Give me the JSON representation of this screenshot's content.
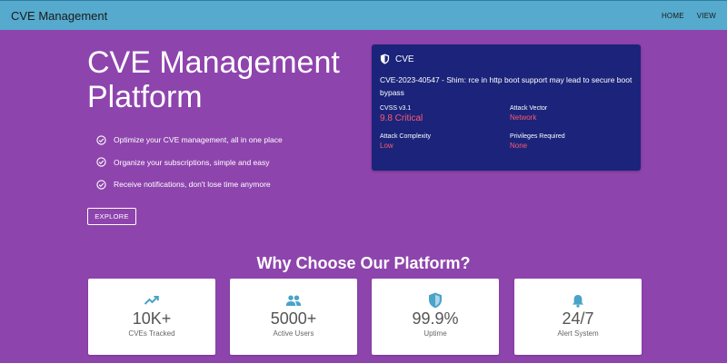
{
  "navbar": {
    "brand": "CVE Management",
    "links": [
      "HOME",
      "VIEW"
    ]
  },
  "hero": {
    "title": "CVE Management Platform",
    "features": [
      "Optimize your CVE management, all in one place",
      "Organize your subscriptions, simple and easy",
      "Receive notifications, don't lose time anymore"
    ],
    "explore_label": "EXPLORE"
  },
  "cve_card": {
    "header": "CVE",
    "description": "CVE-2023-40547 - Shim: rce in http boot support may lead to secure boot bypass",
    "metrics": [
      {
        "label": "CVSS v3.1",
        "value": "9.8 Critical"
      },
      {
        "label": "Attack Vector",
        "value": "Network"
      },
      {
        "label": "Attack Complexity",
        "value": "Low"
      },
      {
        "label": "Privileges Required",
        "value": "None"
      }
    ]
  },
  "why": {
    "title": "Why Choose Our Platform?",
    "stats": [
      {
        "icon": "trending-up-icon",
        "value": "10K+",
        "label": "CVEs Tracked"
      },
      {
        "icon": "users-icon",
        "value": "5000+",
        "label": "Active Users"
      },
      {
        "icon": "shield-check-icon",
        "value": "99.9%",
        "label": "Uptime"
      },
      {
        "icon": "bell-icon",
        "value": "24/7",
        "label": "Alert System"
      }
    ]
  },
  "colors": {
    "background": "#8e44ad",
    "navbar": "#55aacd",
    "card": "#1b247a",
    "severity": "#ff5a6e",
    "icon_accent": "#4aa3c8"
  }
}
